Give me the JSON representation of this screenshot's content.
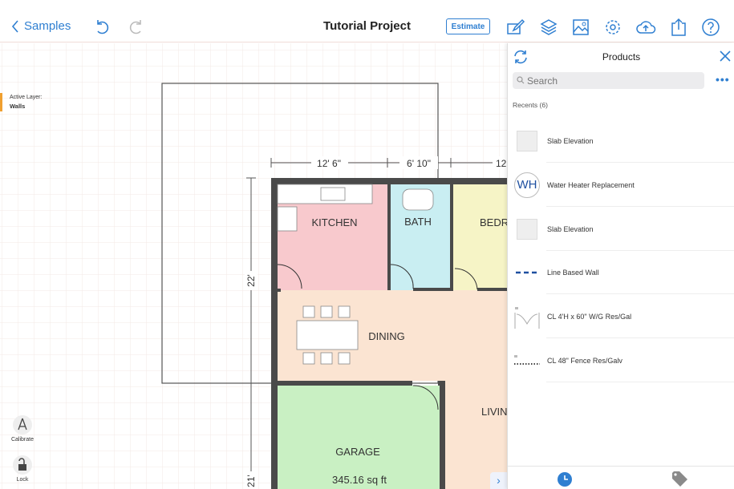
{
  "topbar": {
    "back_label": "Samples",
    "title": "Tutorial Project",
    "estimate_label": "Estimate",
    "icons": [
      "undo-icon",
      "redo-icon",
      "edit-icon",
      "layers-icon",
      "image-icon",
      "gear-icon",
      "cloud-upload-icon",
      "share-icon",
      "help-icon"
    ]
  },
  "colors": {
    "accent": "#2f7fd1",
    "kitchen": "#f8c9cd",
    "bath": "#c9eef2",
    "bedroom": "#f6f4c6",
    "dining": "#fbe4d2",
    "garage": "#c9f0c3",
    "wall": "#4a4a4a"
  },
  "canvas": {
    "active_layer_label": "Active Layer:",
    "active_layer_value": "Walls",
    "rooms": {
      "kitchen": "KITCHEN",
      "bath": "BATH",
      "bedroom": "BEDR",
      "dining": "DINING",
      "garage": "GARAGE",
      "garage_area": "345.16 sq ft",
      "living": "LIVIN"
    },
    "dimensions": {
      "top1": "12' 6\"",
      "top2": "6' 10\"",
      "top3": "12",
      "left1": "22'",
      "left2": "21'"
    },
    "tools": {
      "calibrate": "Calibrate",
      "lock": "Lock"
    }
  },
  "panel": {
    "title": "Products",
    "search_placeholder": "Search",
    "recents_label": "Recents (6)",
    "items": [
      {
        "label": "Slab Elevation",
        "thumb": "slab"
      },
      {
        "label": "Water Heater Replacement",
        "thumb": "WH"
      },
      {
        "label": "Slab Elevation",
        "thumb": "slab"
      },
      {
        "label": "Line Based Wall",
        "thumb": "dashed-line"
      },
      {
        "label": "CL 4'H x 60\" W/G Res/Gal",
        "thumb": "gate"
      },
      {
        "label": "CL 48\" Fence Res/Galv",
        "thumb": "fence"
      }
    ],
    "tabs": [
      {
        "icon": "clock-icon",
        "active": true
      },
      {
        "icon": "tag-icon",
        "active": false
      }
    ]
  }
}
